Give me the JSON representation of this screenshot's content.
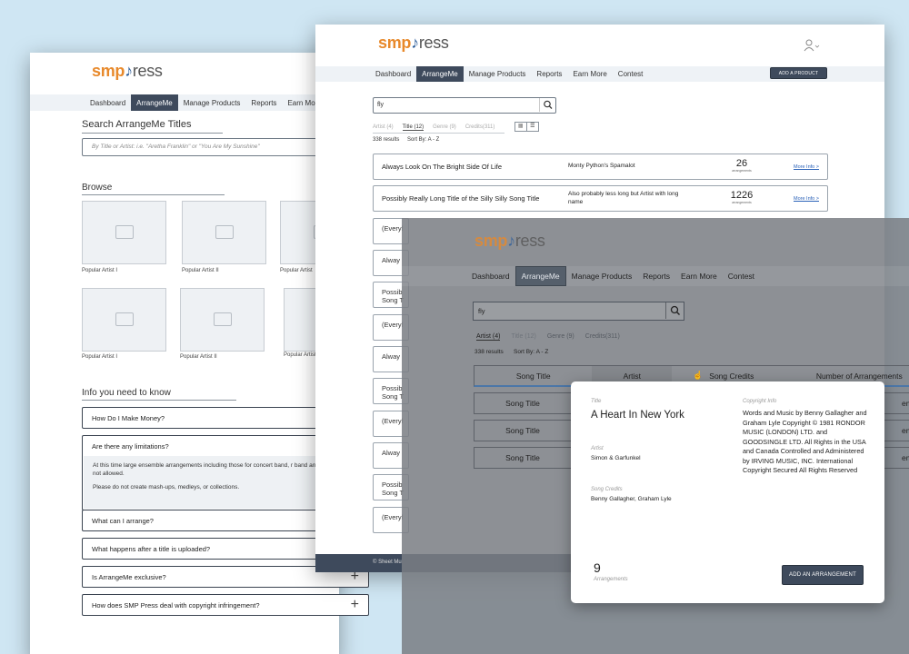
{
  "logo": {
    "smp": "smp",
    "press": "ress"
  },
  "nav": [
    "Dashboard",
    "ArrangeMe",
    "Manage Products",
    "Reports",
    "Earn More",
    "Contest"
  ],
  "left": {
    "search_title": "Search ArrangeMe Titles",
    "search_placeholder": "By Title or Artist: i.e. \"Aretha Franklin\" or \"You Are My Sunshine\"",
    "browse_title": "Browse",
    "captions": [
      "Popular Artist I",
      "Popular Artist II",
      "Popular Artist",
      "Popular Artist I",
      "Popular Artist II",
      "Popular Artist"
    ],
    "info_title": "Info you need to know",
    "faq": [
      {
        "q": "How Do I Make Money?"
      },
      {
        "q": "Are there any limitations?",
        "body1": "At this time large ensemble arrangements including those for concert band, r band and orchestra are not allowed.",
        "body2": "Please do not create mash-ups, medleys, or collections."
      },
      {
        "q": "What can I arrange?"
      },
      {
        "q": "What happens after a title is uploaded?"
      },
      {
        "q": "Is ArrangeMe exclusive?",
        "icon": "+"
      },
      {
        "q": "How does SMP Press deal with copyright infringement?",
        "icon": "+"
      }
    ]
  },
  "middle": {
    "add_product": "ADD A PRODUCT",
    "search_value": "fly",
    "tabs": [
      "Artist (4)",
      "Title (12)",
      "Genre (9)",
      "Credits(311)"
    ],
    "results": "338 results",
    "sort": "Sort By: A - Z",
    "rows": [
      {
        "title": "Always Look On The Bright Side Of Life",
        "artist": "Monty Python's Spamalot",
        "count": "26",
        "unit": "arrangements",
        "more": "More Info >"
      },
      {
        "title": "Possibly Really Long Title of the Silly Silly Song Title",
        "artist": "Also probably less long but Artist with long name",
        "count": "1226",
        "unit": "arrangements",
        "more": "More Info >"
      }
    ],
    "partial_rows": [
      "(Everyl",
      "Alway",
      "Possib Song T",
      "(Everyl",
      "Alway",
      "Possib Song T",
      "(Everyl",
      "Alway",
      "Possib Song T",
      "(Everyl"
    ],
    "footer": "© Sheet Mu"
  },
  "overlay": {
    "search_value": "fly",
    "tabs": [
      "Artist (4)",
      "Title (12)",
      "Genre (9)",
      "Credits(311)"
    ],
    "results": "338 results",
    "sort": "Sort By: A - Z",
    "columns": [
      "Song Title",
      "Artist",
      "Song Credits",
      "Number of Arrangements"
    ],
    "row_title": "Song Title",
    "row_tail": "ements"
  },
  "modal": {
    "title_label": "Title",
    "title": "A Heart In New York",
    "artist_label": "Artist",
    "artist": "Simon & Garfunkel",
    "credits_label": "Song Credits",
    "credits": "Benny Gallagher, Graham Lyle",
    "copyright_label": "Copyright Info",
    "copyright": "Words and Music by Benny Gallagher and Graham Lyle Copyright © 1981 RONDOR MUSIC (LONDON) LTD. and GOODSINGLE LTD. All Rights in the USA and Canada Controlled and Administered by IRVING MUSIC, INC. International Copyright Secured All Rights Reserved",
    "count": "9",
    "count_label": "Arrangements",
    "button": "ADD AN ARRANGEMENT"
  }
}
